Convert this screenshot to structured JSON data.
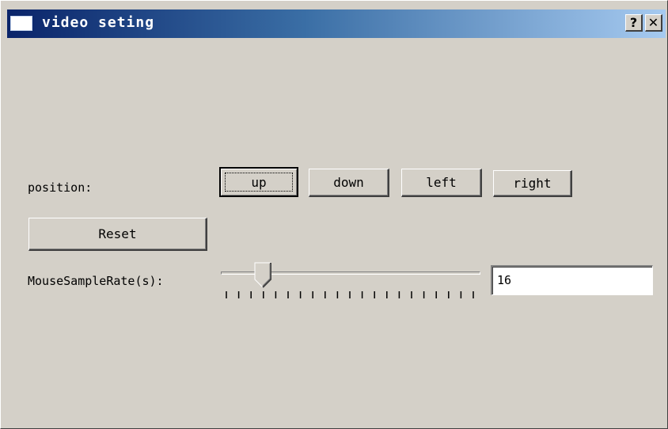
{
  "window": {
    "title": "video seting",
    "help_label": "?",
    "close_label": "✕"
  },
  "position": {
    "label": "position:",
    "buttons": [
      "up",
      "down",
      "left",
      "right"
    ],
    "focused": "up"
  },
  "reset_label": "Reset",
  "mouse_sample_rate": {
    "label": "MouseSampleRate(s):",
    "value": "16",
    "slider_fraction": 0.16,
    "tick_count": 21
  },
  "colors": {
    "face": "#d4d0c8",
    "title_gradient_start": "#0a246a",
    "title_gradient_end": "#a6caf0"
  }
}
